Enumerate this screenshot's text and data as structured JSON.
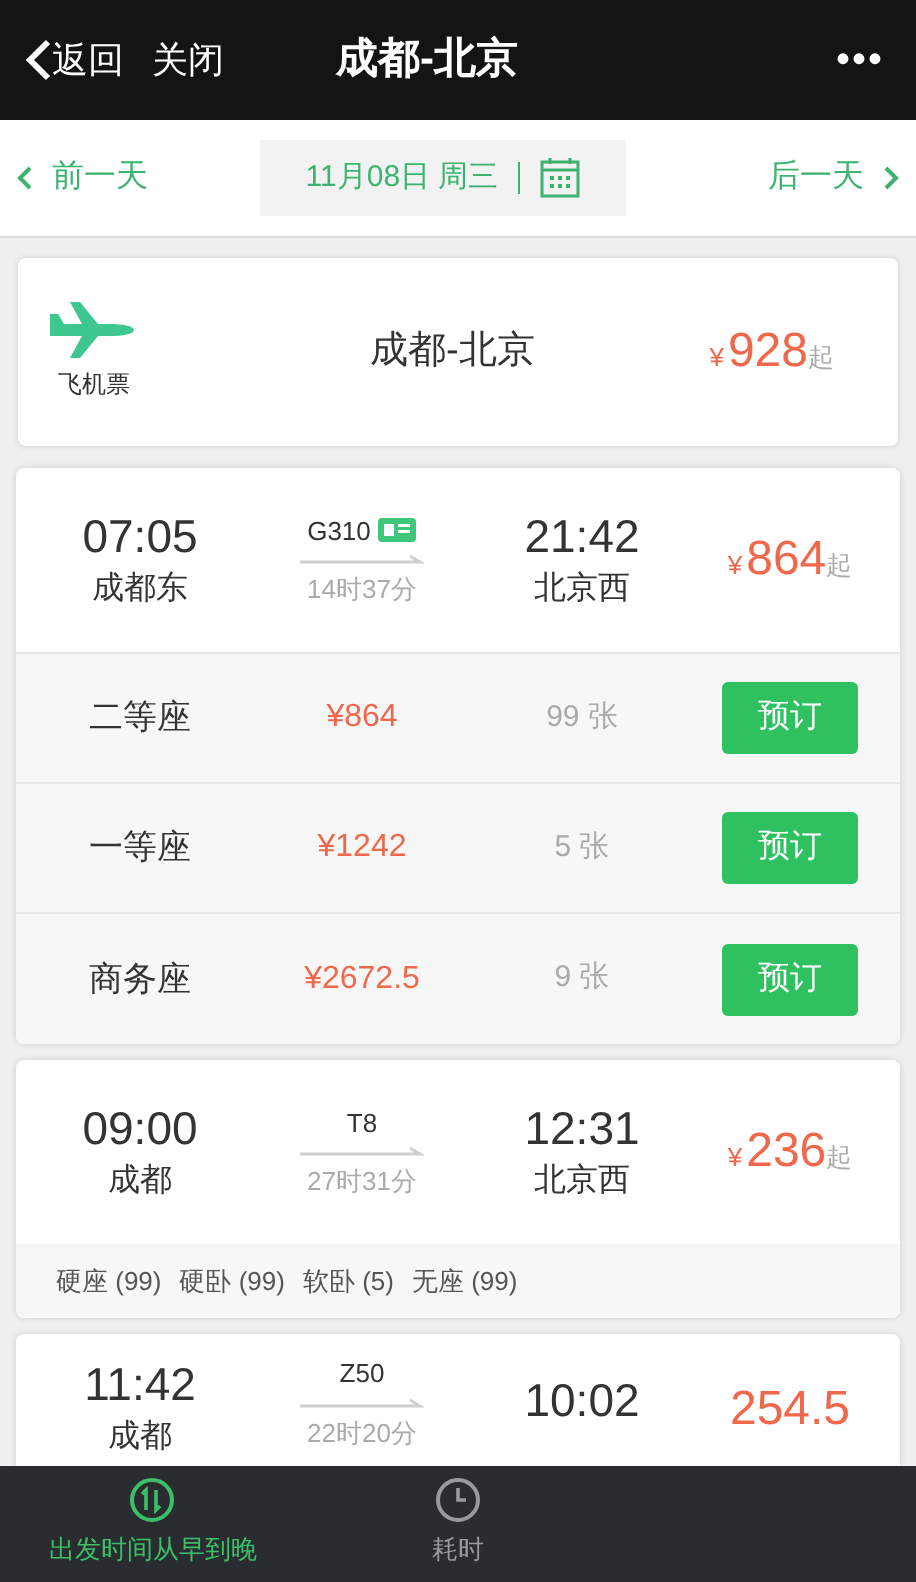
{
  "header": {
    "back": "返回",
    "close": "关闭",
    "title": "成都-北京",
    "more": "•••"
  },
  "date_bar": {
    "prev": "前一天",
    "date": "11月08日 周三",
    "next": "后一天"
  },
  "flight": {
    "label": "飞机票",
    "route": "成都-北京",
    "currency": "¥",
    "price": "928",
    "suffix": "起"
  },
  "trains": [
    {
      "depart_time": "07:05",
      "depart_station": "成都东",
      "number": "G310",
      "id_badge": true,
      "duration": "14时37分",
      "arrive_time": "21:42",
      "arrive_station": "北京西",
      "currency": "¥",
      "price": "864",
      "suffix": "起",
      "expanded": true,
      "seats": [
        {
          "name": "二等座",
          "price": "¥864",
          "count": "99 张",
          "action": "预订"
        },
        {
          "name": "一等座",
          "price": "¥1242",
          "count": "5 张",
          "action": "预订"
        },
        {
          "name": "商务座",
          "price": "¥2672.5",
          "count": "9 张",
          "action": "预订"
        }
      ]
    },
    {
      "depart_time": "09:00",
      "depart_station": "成都",
      "number": "T8",
      "id_badge": false,
      "duration": "27时31分",
      "arrive_time": "12:31",
      "arrive_station": "北京西",
      "currency": "¥",
      "price": "236",
      "suffix": "起",
      "expanded": false,
      "summary": [
        "硬座 (99)",
        "硬卧 (99)",
        "软卧 (5)",
        "无座 (99)"
      ]
    },
    {
      "depart_time": "11:42",
      "depart_station": "成都",
      "number": "Z50",
      "id_badge": false,
      "duration": "22时20分",
      "arrive_time": "10:02",
      "price": "254.5",
      "expanded": false
    }
  ],
  "bottom_bar": [
    {
      "kind": "sort",
      "label": "出发时间从早到晚",
      "selected": true
    },
    {
      "kind": "clock",
      "label": "耗时",
      "selected": false
    }
  ]
}
